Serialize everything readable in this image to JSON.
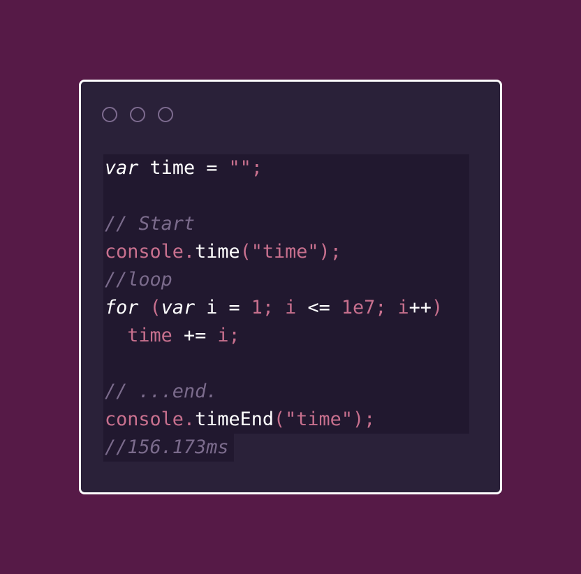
{
  "window": {
    "controls": [
      "circle",
      "circle",
      "circle"
    ]
  },
  "code_lines": [
    [
      {
        "t": "var",
        "c": "k"
      },
      {
        "t": " ",
        "c": "w"
      },
      {
        "t": "time",
        "c": "w"
      },
      {
        "t": " = ",
        "c": "w"
      },
      {
        "t": "\"\";",
        "c": "p"
      }
    ],
    [],
    [
      {
        "t": "// Start",
        "c": "c"
      }
    ],
    [
      {
        "t": "console.",
        "c": "p"
      },
      {
        "t": "time",
        "c": "w"
      },
      {
        "t": "(\"time\");",
        "c": "p"
      }
    ],
    [
      {
        "t": "//loop",
        "c": "c"
      }
    ],
    [
      {
        "t": "for",
        "c": "k"
      },
      {
        "t": " (",
        "c": "p"
      },
      {
        "t": "var",
        "c": "k"
      },
      {
        "t": " i = ",
        "c": "w"
      },
      {
        "t": "1; i ",
        "c": "p"
      },
      {
        "t": "<=",
        "c": "w"
      },
      {
        "t": " 1e7; i",
        "c": "p"
      },
      {
        "t": "++",
        "c": "w"
      },
      {
        "t": ")",
        "c": "p"
      }
    ],
    [
      {
        "t": "  time ",
        "c": "p"
      },
      {
        "t": "+=",
        "c": "w"
      },
      {
        "t": " i;",
        "c": "p"
      }
    ],
    [],
    [
      {
        "t": "// ...end.",
        "c": "c"
      }
    ],
    [
      {
        "t": "console.",
        "c": "p"
      },
      {
        "t": "timeEnd",
        "c": "w"
      },
      {
        "t": "(\"time\");",
        "c": "p"
      }
    ],
    [
      {
        "t": "//156.173ms",
        "c": "c"
      }
    ]
  ],
  "colors": {
    "background": "#561a47",
    "window": "#2a2139",
    "code_bg": "#21182f",
    "keyword_pink": "#c8708e",
    "comment": "#7b6b8c",
    "text": "#ffffff"
  }
}
